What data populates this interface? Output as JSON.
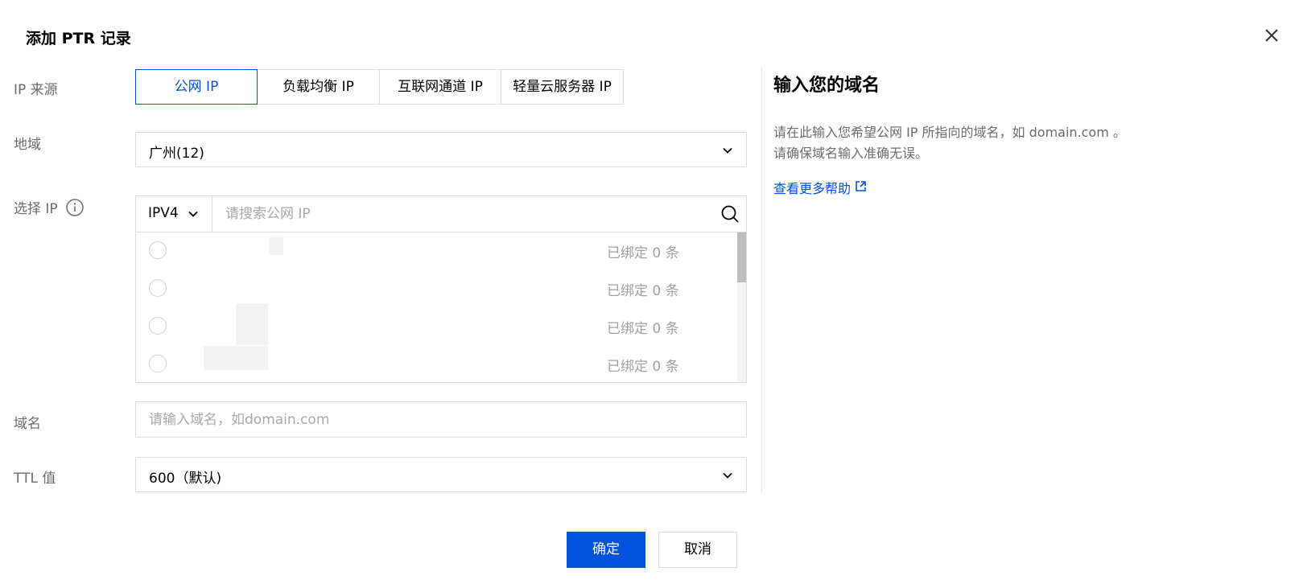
{
  "dialog": {
    "title": "添加 PTR 记录"
  },
  "form": {
    "ip_source_label": "IP 来源",
    "ip_source_tabs": [
      {
        "label": "公网 IP",
        "active": true
      },
      {
        "label": "负载均衡 IP",
        "active": false
      },
      {
        "label": "互联网通道 IP",
        "active": false
      },
      {
        "label": "轻量云服务器 IP",
        "active": false
      }
    ],
    "region_label": "地域",
    "region_value": "广州(12)",
    "select_ip_label": "选择 IP",
    "ip_version": "IPV4",
    "ip_search_placeholder": "请搜索公网 IP",
    "ip_list": [
      {
        "address": "",
        "bound": "已绑定 0 条"
      },
      {
        "address": "",
        "bound": "已绑定 0 条"
      },
      {
        "address": "",
        "bound": "已绑定 0 条"
      },
      {
        "address": "",
        "bound": "已绑定 0 条"
      }
    ],
    "domain_label": "域名",
    "domain_placeholder": "请输入域名，如domain.com",
    "ttl_label": "TTL 值",
    "ttl_value": "600（默认)"
  },
  "help": {
    "title": "输入您的域名",
    "line1": "请在此输入您希望公网 IP 所指向的域名，如 domain.com 。",
    "line2": "请确保域名输入准确无误。",
    "link": "查看更多帮助"
  },
  "buttons": {
    "confirm": "确定",
    "cancel": "取消"
  },
  "colors": {
    "primary": "#0052d9",
    "border": "#dcdcdc",
    "label": "#6b6b6b",
    "placeholder": "#a8a8a8"
  }
}
